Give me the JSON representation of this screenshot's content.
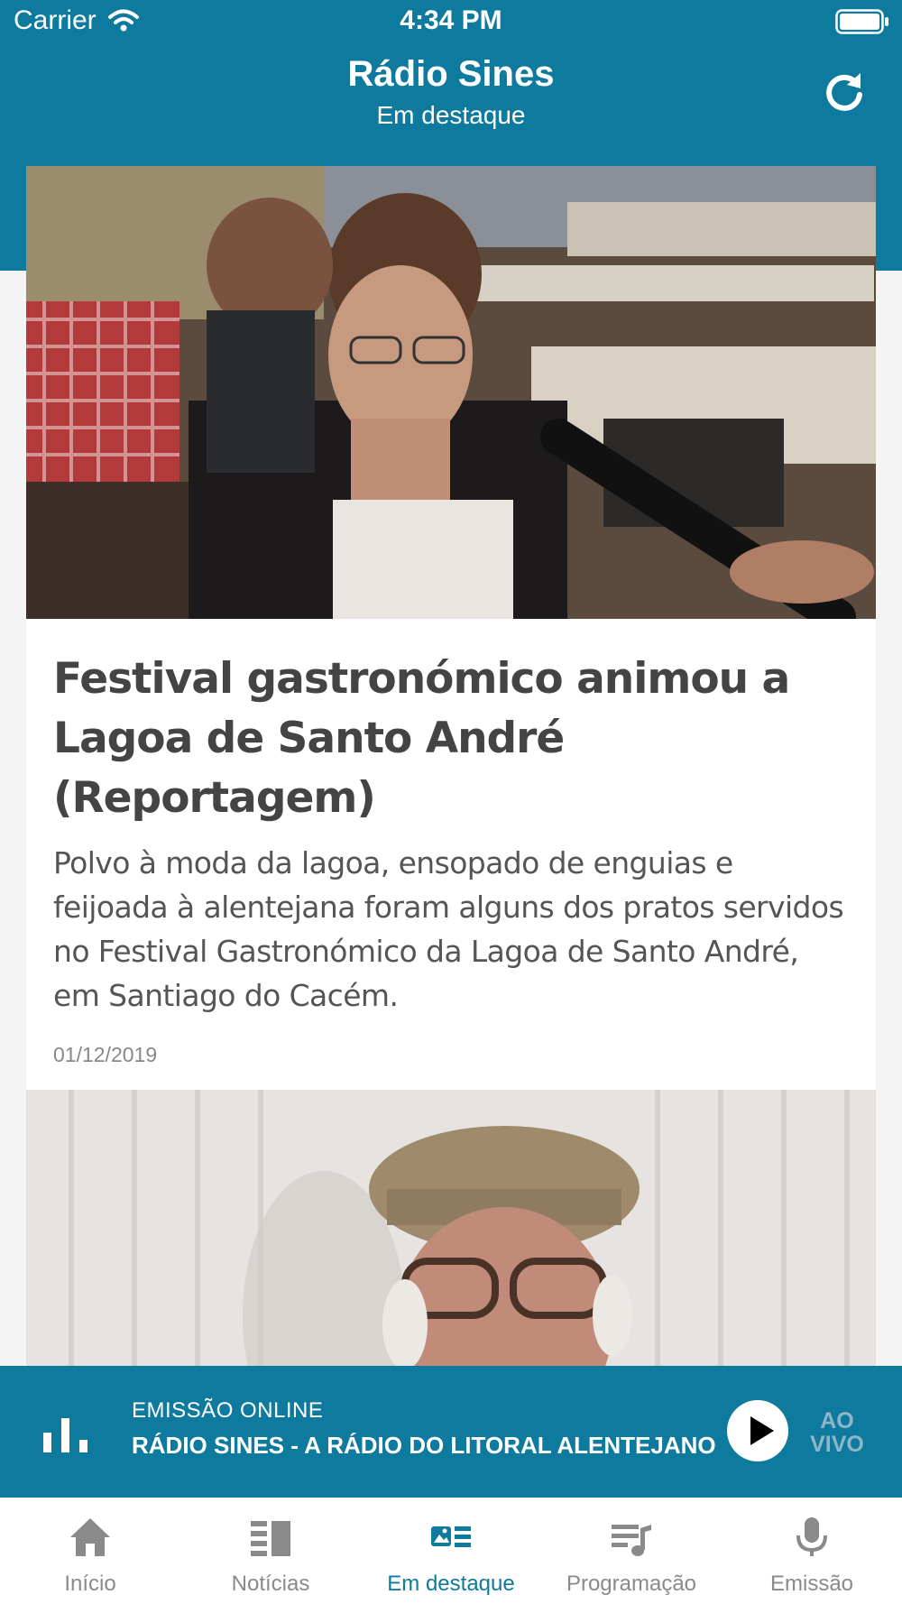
{
  "status_bar": {
    "carrier": "Carrier",
    "time": "4:34 PM"
  },
  "nav": {
    "title": "Rádio Sines",
    "subtitle": "Em destaque",
    "refresh_icon": "refresh-icon"
  },
  "articles": [
    {
      "title": "Festival gastronómico animou a Lagoa de Santo André (Reportagem)",
      "summary": "Polvo à moda da lagoa, ensopado de enguias e feijoada à alentejana foram alguns dos pratos servidos no Festival Gastronómico da Lagoa de Santo André, em Santiago do Cacém.",
      "date": "01/12/2019"
    }
  ],
  "player": {
    "label": "EMISSÃO ONLINE",
    "station": "RÁDIO SINES - A RÁDIO DO LITORAL ALENTEJANO",
    "live_line1": "AO",
    "live_line2": "VIVO"
  },
  "tabs": [
    {
      "label": "Início",
      "icon": "home-icon",
      "active": false
    },
    {
      "label": "Notícias",
      "icon": "news-icon",
      "active": false
    },
    {
      "label": "Em destaque",
      "icon": "featured-icon",
      "active": true
    },
    {
      "label": "Programação",
      "icon": "playlist-icon",
      "active": false
    },
    {
      "label": "Emissão",
      "icon": "microphone-icon",
      "active": false
    }
  ],
  "colors": {
    "primary": "#0e7a9d",
    "tab_inactive": "#8a8a8a",
    "background": "#f4f4f4"
  }
}
